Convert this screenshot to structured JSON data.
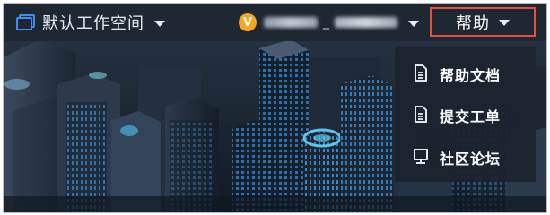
{
  "topbar": {
    "workspace_label": "默认工作空间",
    "user_initial": "V",
    "help_label": "帮助"
  },
  "help_menu": {
    "items": [
      {
        "label": "帮助文档",
        "icon": "document-icon"
      },
      {
        "label": "提交工单",
        "icon": "document-icon"
      },
      {
        "label": "社区论坛",
        "icon": "monitor-icon"
      }
    ]
  },
  "colors": {
    "topbar_bg": "#1e2632",
    "highlight_border": "#e0533e",
    "avatar": "#f5a623",
    "workspace_icon": "#3d8ef0"
  }
}
